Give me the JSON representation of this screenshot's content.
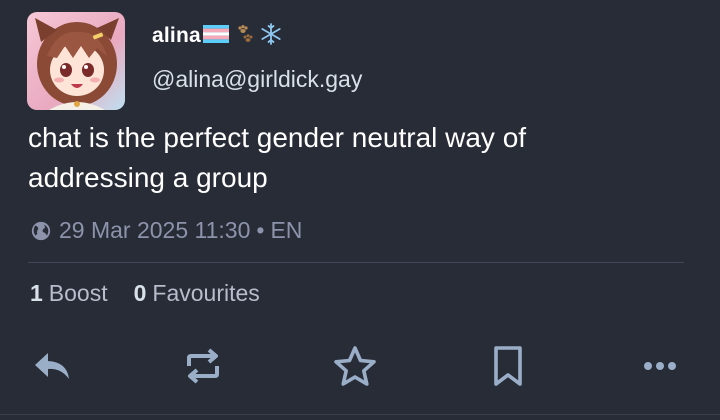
{
  "account": {
    "display_name": "alina",
    "handle": "@alina@girldick.gay",
    "emojis": [
      "trans-flag-emoji",
      "paw-prints-emoji",
      "snowflake-emoji"
    ]
  },
  "post": {
    "text": "chat is the perfect gender neutral way of addressing a group",
    "visibility_icon": "globe-icon",
    "timestamp": "29 Mar 2025 11:30",
    "separator": "•",
    "language": "EN"
  },
  "stats": {
    "boost_count": "1",
    "boost_label": "Boost",
    "favourite_count": "0",
    "favourite_label": "Favourites"
  },
  "actions": [
    "reply-icon",
    "boost-icon",
    "favourite-star-icon",
    "bookmark-icon",
    "more-dots-icon"
  ],
  "colors": {
    "background": "#282c37",
    "text_primary": "#ffffff",
    "text_secondary": "#8d93ab",
    "icon": "#9baec8"
  }
}
